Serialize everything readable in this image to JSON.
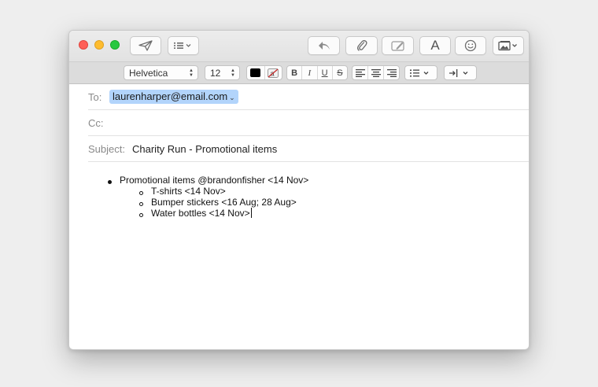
{
  "compose": {
    "to_label": "To:",
    "to_recipient": "laurenharper@email.com",
    "cc_label": "Cc:",
    "cc_value": "",
    "subject_label": "Subject:",
    "subject_value": "Charity Run - Promotional items"
  },
  "format": {
    "font": "Helvetica",
    "size": "12",
    "text_color": "#000000",
    "bold": "B",
    "italic": "I",
    "underline": "U",
    "strike": "S"
  },
  "toolbar": {
    "text_style": "A"
  },
  "body": {
    "items": [
      {
        "text": "Promotional items @brandonfisher <14 Nov>",
        "children": [
          {
            "text": "T-shirts <14 Nov>"
          },
          {
            "text": "Bumper stickers <16 Aug; 28 Aug>"
          },
          {
            "text": "Water bottles <14 Nov>"
          }
        ]
      }
    ]
  },
  "colors": {
    "close": "#fe5f57",
    "minimize": "#febc2e",
    "zoom": "#28c840",
    "recipient_token": "#b2d4fb"
  },
  "icons": [
    "send-icon",
    "header-fields-icon",
    "reply-icon",
    "attach-icon",
    "markup-icon",
    "format-text-icon",
    "emoji-icon",
    "photo-browser-icon"
  ]
}
